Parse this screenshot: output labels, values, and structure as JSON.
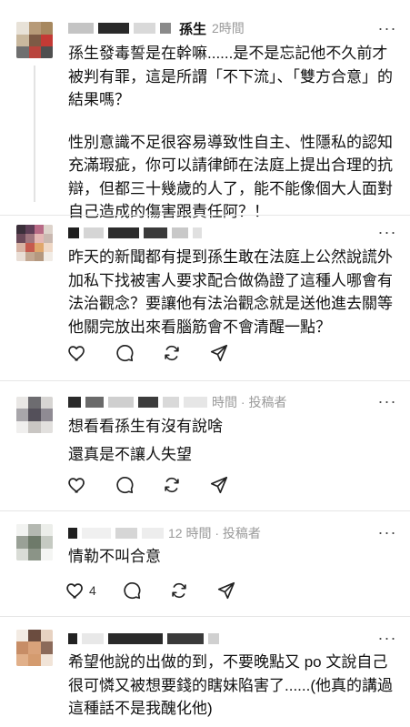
{
  "posts": [
    {
      "username": "孫生",
      "time": "2時間",
      "more_label": "···",
      "paragraphs": [
        "孫生發毒誓是在幹嘛......是不是忘記他不久前才被判有罪，這是所謂「不下流」、「雙方合意」的結果嗎？",
        "性別意識不足很容易導致性自主、性隱私的認知充滿瑕疵，你可以請律師在法庭上提出合理的抗辯，但都三十幾歲的人了，能不能像個大人面對自己造成的傷害跟責任阿？！"
      ]
    },
    {
      "more_label": "···",
      "paragraphs": [
        "昨天的新聞都有提到孫生敢在法庭上公然說謊外加私下找被害人要求配合做偽證了這種人哪會有法治觀念？要讓他有法治觀念就是送他進去關等他關完放出來看腦筋會不會清醒一點？"
      ]
    },
    {
      "meta": "時間 · 投稿者",
      "more_label": "···",
      "paragraphs": [
        "想看看孫生有沒有說啥",
        "還真是不讓人失望"
      ]
    },
    {
      "meta": "12 時間 · 投稿者",
      "more_label": "···",
      "paragraphs": [
        "情勒不叫合意"
      ],
      "like_count": "4"
    },
    {
      "more_label": "···",
      "paragraphs": [
        "希望他說的出做的到，不要晚點又 po 文說自己很可憐又被想要錢的瞎妹陷害了......(他真的講過這種話不是我醜化他)"
      ]
    }
  ],
  "icons": [
    "heart-icon",
    "comment-icon",
    "repost-icon",
    "share-icon",
    "more-icon"
  ],
  "colors": {
    "text": "#111111",
    "meta": "#9a9a9a",
    "divider": "#e6e6e6",
    "thread_line": "#e3e3e3"
  }
}
